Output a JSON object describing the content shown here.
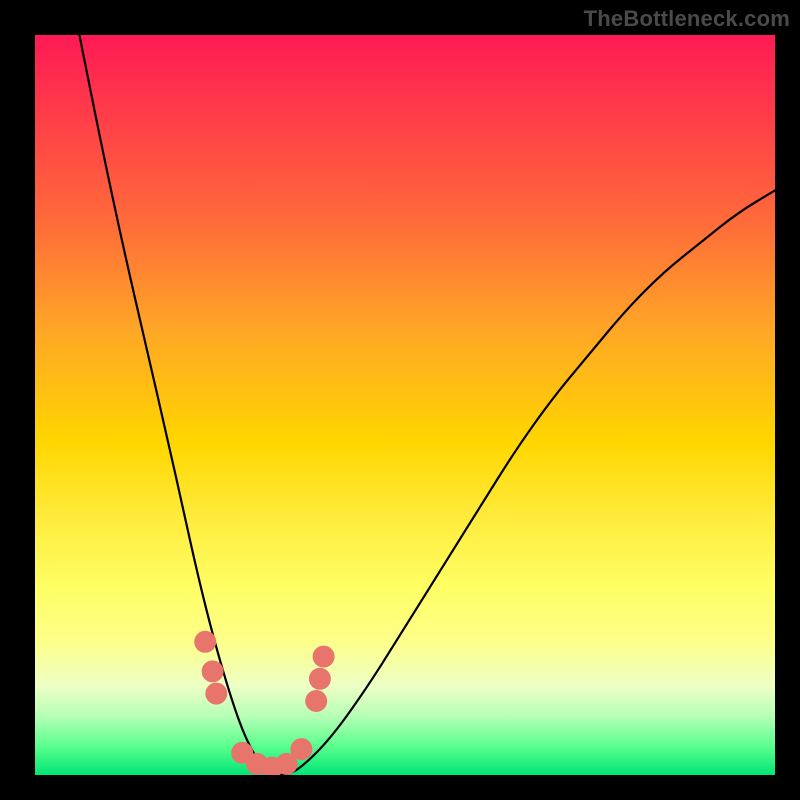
{
  "watermark": "TheBottleneck.com",
  "chart_data": {
    "type": "line",
    "title": "",
    "xlabel": "",
    "ylabel": "",
    "xlim": [
      0,
      100
    ],
    "ylim": [
      0,
      100
    ],
    "series": [
      {
        "name": "bottleneck-curve",
        "x": [
          6,
          9,
          12,
          15,
          18,
          20,
          22,
          24,
          26,
          28,
          30,
          32,
          34,
          36,
          40,
          45,
          50,
          55,
          60,
          65,
          70,
          75,
          80,
          85,
          90,
          95,
          100
        ],
        "y": [
          100,
          85,
          71,
          58,
          45,
          36,
          27,
          19,
          12,
          6,
          2,
          0,
          0,
          1,
          5,
          12,
          20,
          28,
          36,
          44,
          51,
          57,
          63,
          68,
          72,
          76,
          79
        ]
      }
    ],
    "markers": {
      "name": "highlight-dots",
      "color": "#e8756b",
      "points": [
        {
          "x": 23,
          "y": 18
        },
        {
          "x": 24,
          "y": 14
        },
        {
          "x": 24.5,
          "y": 11
        },
        {
          "x": 28,
          "y": 3
        },
        {
          "x": 30,
          "y": 1.5
        },
        {
          "x": 32,
          "y": 1
        },
        {
          "x": 34,
          "y": 1.5
        },
        {
          "x": 36,
          "y": 3.5
        },
        {
          "x": 38,
          "y": 10
        },
        {
          "x": 38.5,
          "y": 13
        },
        {
          "x": 39,
          "y": 16
        }
      ]
    },
    "background_gradient": {
      "top": "#ff1a55",
      "mid": "#ffd600",
      "bottom": "#00e676"
    }
  }
}
